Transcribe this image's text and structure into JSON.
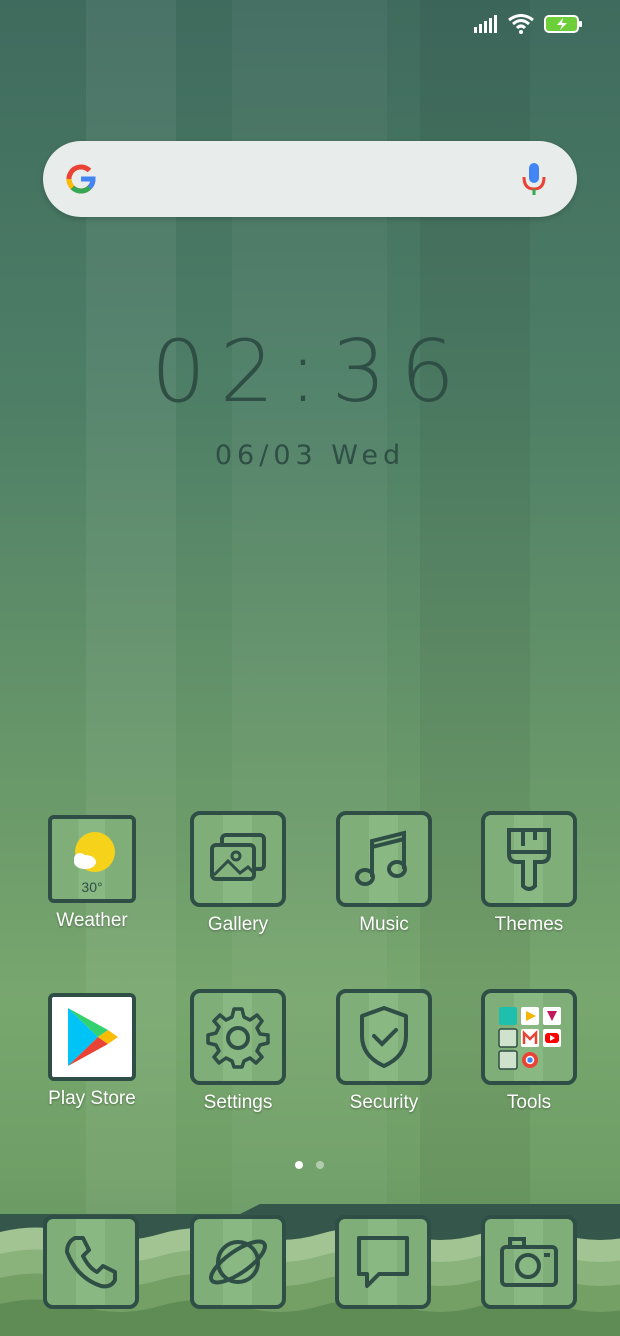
{
  "clock": {
    "time": "02:36",
    "date": "06/03  Wed"
  },
  "weather": {
    "temperature": "30°"
  },
  "apps": [
    {
      "label": "Weather",
      "icon": "weather-icon"
    },
    {
      "label": "Gallery",
      "icon": "gallery-icon"
    },
    {
      "label": "Music",
      "icon": "music-icon"
    },
    {
      "label": "Themes",
      "icon": "themes-icon"
    },
    {
      "label": "Play Store",
      "icon": "play-store-icon"
    },
    {
      "label": "Settings",
      "icon": "gear-icon"
    },
    {
      "label": "Security",
      "icon": "shield-icon"
    },
    {
      "label": "Tools",
      "icon": "folder-icon"
    }
  ],
  "dock": [
    {
      "icon": "phone-icon"
    },
    {
      "icon": "browser-icon"
    },
    {
      "icon": "messages-icon"
    },
    {
      "icon": "camera-icon"
    }
  ],
  "page_indicator": {
    "total_pages": 2,
    "current_page": 1
  },
  "colors": {
    "icon_stroke": "#2f4e45",
    "accent_green": "#6ccf3a",
    "battery_green": "#6ccf3a"
  }
}
